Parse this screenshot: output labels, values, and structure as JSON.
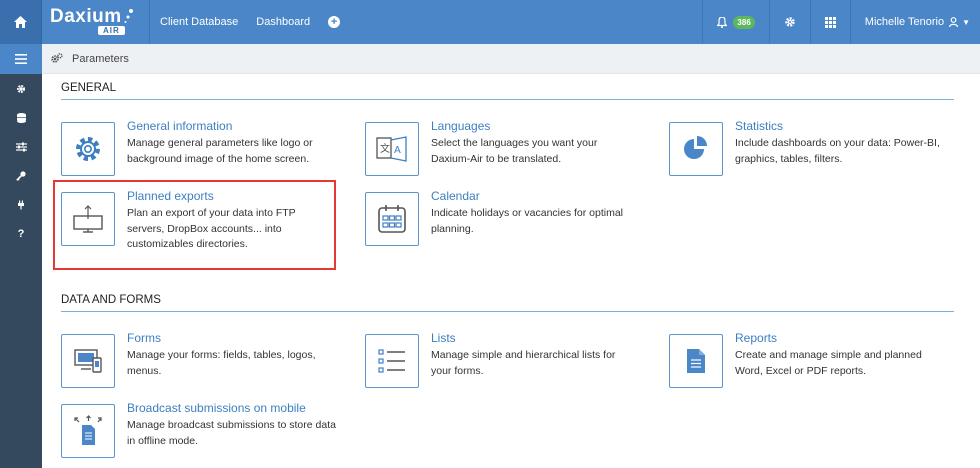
{
  "topbar": {
    "brand": "Daxium",
    "brand_sub": "AIR",
    "nav": [
      "Client Database",
      "Dashboard"
    ],
    "notifications_count": "386",
    "user_name": "Michelle Tenorio"
  },
  "breadcrumb": {
    "label": "Parameters"
  },
  "sections": {
    "general": {
      "title": "GENERAL",
      "cards": [
        {
          "title": "General information",
          "desc": "Manage general parameters like logo or background image of the home screen.",
          "icon": "gear-icon"
        },
        {
          "title": "Languages",
          "desc": "Select the languages you want your Daxium-Air to be translated.",
          "icon": "translate-icon"
        },
        {
          "title": "Statistics",
          "desc": "Include dashboards on your data: Power-BI, graphics, tables, filters.",
          "icon": "pie-chart-icon"
        },
        {
          "title": "Planned exports",
          "desc": "Plan an export of your data into FTP servers, DropBox accounts... into customizables directories.",
          "icon": "monitor-upload-icon"
        },
        {
          "title": "Calendar",
          "desc": "Indicate holidays or vacancies for optimal planning.",
          "icon": "calendar-icon"
        }
      ]
    },
    "data_forms": {
      "title": "DATA AND FORMS",
      "cards": [
        {
          "title": "Forms",
          "desc": "Manage your forms: fields, tables, logos, menus.",
          "icon": "devices-icon"
        },
        {
          "title": "Lists",
          "desc": "Manage simple and hierarchical lists for your forms.",
          "icon": "list-icon"
        },
        {
          "title": "Reports",
          "desc": "Create and manage simple and planned Word, Excel or PDF reports.",
          "icon": "document-icon"
        },
        {
          "title": "Broadcast submissions on mobile",
          "desc": "Manage broadcast submissions to store data in offline mode.",
          "icon": "broadcast-document-icon"
        }
      ]
    }
  },
  "colors": {
    "primary": "#4a86c8",
    "sidebar": "#34495e",
    "highlight": "#e53935",
    "badge": "#5cb85c"
  }
}
